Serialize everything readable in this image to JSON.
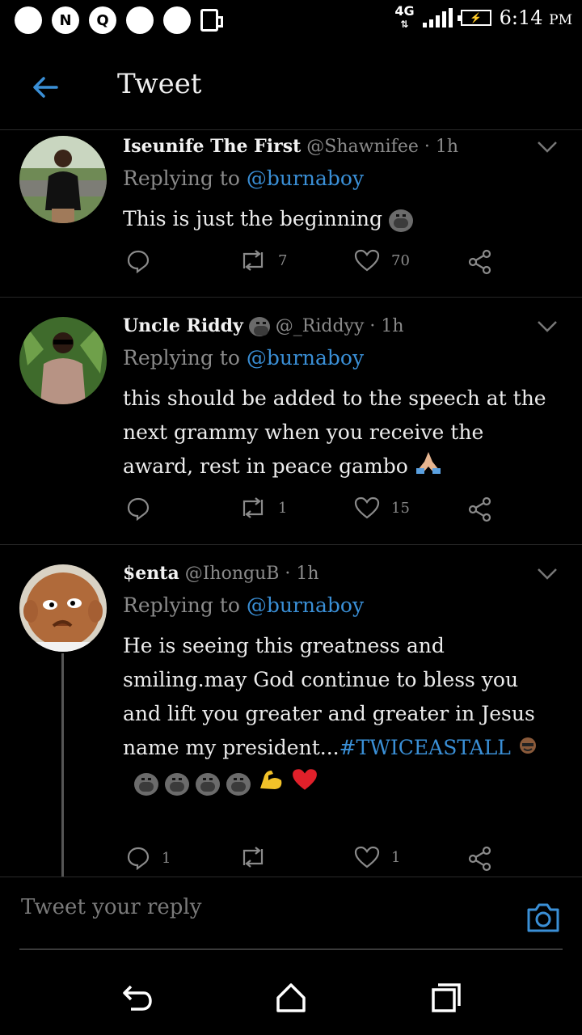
{
  "status_bar": {
    "left_icons": [
      "notification-dot",
      "n-app-icon",
      "q-app-icon",
      "notification-dot",
      "notification-dot",
      "phone-icon"
    ],
    "n_letter": "N",
    "q_letter": "Q",
    "network": "4G",
    "time": "6:14",
    "ampm": "PM"
  },
  "header": {
    "back_icon": "arrow-left-icon",
    "title": "Tweet"
  },
  "tweets": [
    {
      "name": "Iseunife The First",
      "handle": "@Shawnifee · 1h",
      "replying_prefix": "Replying to",
      "replying_to": "@burnaboy",
      "text": "This is just the beginning",
      "retweets": "7",
      "likes": "70",
      "replies": ""
    },
    {
      "name": "Uncle Riddy",
      "handle": "@_Riddyy · 1h",
      "replying_prefix": "Replying to",
      "replying_to": "@burnaboy",
      "text": "this should be added to the speech at the next grammy when you receive the award, rest in peace gambo",
      "retweets": "1",
      "likes": "15",
      "replies": ""
    },
    {
      "name": "$enta",
      "handle": "@IhonguB · 1h",
      "replying_prefix": "Replying to",
      "replying_to": "@burnaboy",
      "text": "He is seeing this greatness and smiling.may God continue to bless you and lift you greater and greater in Jesus name my president...",
      "hashtag": "#TWICEASTALL",
      "replies": "1",
      "retweets": "",
      "likes": "1"
    }
  ],
  "reply_bar": {
    "placeholder": "Tweet your reply",
    "camera_icon": "camera-icon"
  },
  "nav_bar": {
    "icons": [
      "back-icon",
      "home-icon",
      "recents-icon"
    ]
  },
  "colors": {
    "background": "#000000",
    "accent": "#3a8fd6",
    "muted": "#8a8a8a"
  }
}
